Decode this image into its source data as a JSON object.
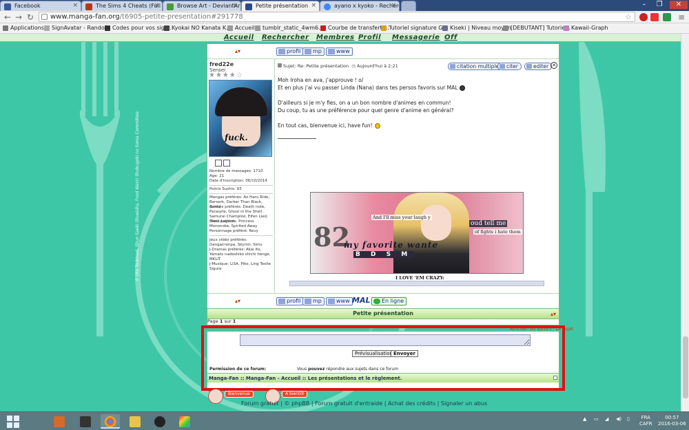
{
  "browser": {
    "tabs": [
      {
        "label": "Facebook",
        "color": "#3b5998"
      },
      {
        "label": "The Sims 4 Cheats (Full Li",
        "color": "#b23a1a"
      },
      {
        "label": "Browse Art - DeviantArt",
        "color": "#4a9a3a"
      },
      {
        "label": "Petite présentation",
        "color": "#2a4a8a",
        "active": true
      },
      {
        "label": "ayano x kyoko - Recherch",
        "color": "#4285f4"
      }
    ],
    "url_domain": "www.manga-fan.org",
    "url_path": "/t6905-petite-presentation#291778",
    "bookmarks": [
      "Applications",
      "SignAvatar - Rando...",
      "Codes pour vos sign...",
      "Kyokai NO Kanata K...",
      "Accueil",
      "tumblr_static_4wm6...",
      "Courbe de transfert ...",
      "Tutoriel signature G...",
      "Kiseki | Niveau moyen",
      "[DEBUTANT] Tutorie...",
      "Kawaii-Graph"
    ]
  },
  "nav": {
    "items": [
      "Accueil",
      "Rechercher",
      "Membres",
      "Profil",
      "Messagerie",
      "Off"
    ]
  },
  "post": {
    "top_buttons": [
      "profil",
      "mp",
      "www"
    ],
    "user": {
      "name": "fred22e",
      "rank": "Sensei",
      "stars": "★★★★☆",
      "avatar_text": "fuck.",
      "messages": "Nombre de messages: 1710",
      "age": "Age: 21",
      "inscription": "Date d'inscription: 06/10/2014",
      "sushis": "Points Sushis: 93",
      "mangas": "Mangas préférés: Ao Haru Ride, Berserk, Darker Than Black, Gantz",
      "animes": "Animés préférés: Death note, Parasyte, Ghost in the Shell, Samurai Champloo, Elfen Lied, Black Lagoon",
      "films": "Films préférés: Princess Mononoke, Spirited Away",
      "personnage": "Personnage préféré: Revy",
      "jeux": "Jeux vidéo préférés: Danganronpa, Skyrim, Sims",
      "dramas": "J-Dramas préférés: Akai Ito, Yamato nadeshiko shichi henge, MKLIT",
      "musique": "J-Musique: LiSA, Piko, Ling Tosite Sigure"
    },
    "subject_prefix": "Sujet: Re: Petite présentation",
    "date": "Aujourd'hui à 2:21",
    "action_buttons": [
      "citation multiple",
      "citer",
      "editer"
    ],
    "lines": [
      "Moh Iroha en ava, j'approuve ! o/",
      "Et en plus j'ai vu passer Linda (Nana) dans tes persos favoris sur MAL",
      "D'ailleurs si je m'y fies, on a un bon nombre d'animes en commun!",
      "Du coup, tu as une préférence pour quel genre d'anime en général?",
      "En tout cas, bienvenue ici, have fun!"
    ],
    "signature": {
      "quote1": "And I'll miss your laugh y",
      "quote2": "oud tell me",
      "quote3": "of fights i hate them",
      "script1": "my favorite wante",
      "script2": "B D S M",
      "numbers": "82",
      "caption": "I LOVE 'EM CRAZY:"
    },
    "bottom_buttons": [
      "profil",
      "mp",
      "www",
      "MAL",
      "En ligne"
    ]
  },
  "topic_title": "Petite présentation",
  "page_info": {
    "prefix": "Page",
    "current": "1",
    "sep": "sur",
    "total": "1"
  },
  "right_notice": "Afficher: du sortir·i · Le sujet",
  "reply": {
    "textarea_value": "",
    "preview_label": "Prévisualisation",
    "send_label": "Envoyer",
    "permission_label": "Permission de ce forum:",
    "permission_text_1": "Vous",
    "permission_text_bold": "pouvez",
    "permission_text_2": "répondre aux sujets dans ce forum",
    "breadcrumb": "Manga-Fan :: Manga-Fan - Accueil :: Les présentations et le règlement."
  },
  "footer": {
    "btn1": "Bienvenue",
    "btn2": "A bientôt",
    "links": [
      "Forum gratuit",
      "© phpBB",
      "Forum gratuit d'entraide",
      "Achat des crédits",
      "Signaler un abus"
    ]
  },
  "side_credit": "© Uta Tsukinari, Shun Saeki Shueisha, Food Wars! Shokugeki no Soma Committee",
  "taskbar": {
    "lang": "FRA",
    "kbd": "CAFR",
    "time": "00:57",
    "date": "2016-03-06"
  },
  "colors": {
    "page_bg": "#3ec7a7",
    "highlight_frame": "#e01010",
    "nav_text": "#1a4a2a"
  }
}
